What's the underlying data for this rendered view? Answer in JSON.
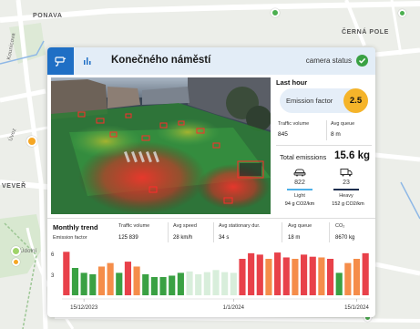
{
  "map": {
    "labels": {
      "ponava": "PONAVA",
      "cerna_pole": "ČERNÁ POLE",
      "vever": "VEVEŘ",
      "udolni": "Údolní",
      "street_left": "Úvoz",
      "street_top_left": "Kounicova"
    },
    "stop_colors": {
      "orange": "#f5a623",
      "green": "#4caf50"
    }
  },
  "card": {
    "title": "Konečného náměstí",
    "camera_status_label": "camera status",
    "tabs": [
      {
        "name": "camera",
        "icon": "camera-icon",
        "active": true
      },
      {
        "name": "chart",
        "icon": "bar-chart-icon",
        "active": false
      }
    ],
    "last_hour": {
      "title": "Last hour",
      "emission_factor_label": "Emission factor",
      "emission_factor_value": "2.5",
      "traffic_volume_label": "Traffic volume",
      "traffic_volume_value": "845",
      "avg_queue_label": "Avg queue",
      "avg_queue_value": "8 m",
      "total_emissions_label": "Total emissions",
      "total_emissions_value": "15.6 kg",
      "light": {
        "count": "822",
        "label": "Light",
        "rate": "94 g CO2/km",
        "icon": "car-icon",
        "color": "#4db0e8"
      },
      "heavy": {
        "count": "23",
        "label": "Heavy",
        "rate": "152 g CO2/km",
        "icon": "truck-icon",
        "color": "#1d2f4f"
      }
    },
    "monthly_trend": {
      "title": "Monthly trend",
      "subtitle": "Emission factor",
      "stats": [
        {
          "label": "Traffic volume",
          "value": "125 839"
        },
        {
          "label": "Avg speed",
          "value": "28 km/h"
        },
        {
          "label": "Avg stationary dur.",
          "value": "34 s"
        },
        {
          "label": "Avg queue",
          "value": "18 m"
        },
        {
          "label": "CO₂",
          "value": "8670 kg"
        }
      ]
    },
    "colors": {
      "accent": "#1f6fc5",
      "status_ok": "#3aa143",
      "badge": "#f5b42a"
    }
  },
  "chart_data": {
    "type": "bar",
    "title": "",
    "xlabel": "",
    "ylabel": "Emission factor",
    "ylim": [
      0,
      6.5
    ],
    "yticks": [
      "3",
      "6"
    ],
    "x_tick_labels": [
      "15/12/2023",
      "1/1/2024",
      "15/1/2024"
    ],
    "categories": [
      "2023-12-13",
      "2023-12-14",
      "2023-12-15",
      "2023-12-16",
      "2023-12-17",
      "2023-12-18",
      "2023-12-19",
      "2023-12-20",
      "2023-12-21",
      "2023-12-22",
      "2023-12-23",
      "2023-12-24",
      "2023-12-25",
      "2023-12-26",
      "2023-12-27",
      "2023-12-28",
      "2023-12-29",
      "2023-12-30",
      "2023-12-31",
      "2024-01-01",
      "2024-01-02",
      "2024-01-03",
      "2024-01-04",
      "2024-01-05",
      "2024-01-06",
      "2024-01-07",
      "2024-01-08",
      "2024-01-09",
      "2024-01-10",
      "2024-01-11",
      "2024-01-12",
      "2024-01-13",
      "2024-01-14",
      "2024-01-15",
      "2024-01-16"
    ],
    "values": [
      6.2,
      3.9,
      3.2,
      3.0,
      4.1,
      4.6,
      3.2,
      4.8,
      4.1,
      3.0,
      2.6,
      2.6,
      2.8,
      3.2,
      3.4,
      3.0,
      3.3,
      3.6,
      3.3,
      3.2,
      5.2,
      6.0,
      5.8,
      5.2,
      6.1,
      5.4,
      5.2,
      5.8,
      5.5,
      5.4,
      5.2,
      3.2,
      4.6,
      5.2,
      6.0
    ],
    "bar_colors": [
      "red",
      "green",
      "green",
      "green",
      "orange",
      "orange",
      "green",
      "red",
      "orange",
      "green",
      "green",
      "green",
      "green",
      "green",
      "lightgreen",
      "lightgreen",
      "lightgreen",
      "lightgreen",
      "lightgreen",
      "lightgreen",
      "red",
      "red",
      "red",
      "orange",
      "red",
      "red",
      "orange",
      "red",
      "red",
      "orange",
      "red",
      "green",
      "orange",
      "orange",
      "red"
    ],
    "palette": {
      "red": "#e8414a",
      "orange": "#f58d4a",
      "green": "#3aa143",
      "lightgreen": "#d8eedb"
    }
  }
}
